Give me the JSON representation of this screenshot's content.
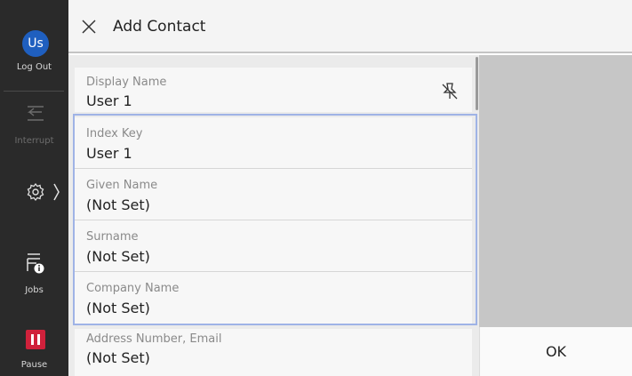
{
  "rail": {
    "avatar_text": "Us",
    "logout_label": "Log Out",
    "interrupt_label": "Interrupt",
    "jobs_label": "Jobs",
    "pause_label": "Pause",
    "accent_color": "#1f5fbf",
    "pause_color": "#d0213b"
  },
  "header": {
    "title": "Add Contact",
    "close_icon": "close-icon"
  },
  "fields": [
    {
      "label": "Display Name",
      "value": "User 1"
    },
    {
      "label": "Index Key",
      "value": "User 1"
    },
    {
      "label": "Given Name",
      "value": "(Not Set)"
    },
    {
      "label": "Surname",
      "value": "(Not Set)"
    },
    {
      "label": "Company Name",
      "value": "(Not Set)"
    },
    {
      "label": "Address Number, Email",
      "value": "(Not Set)"
    }
  ],
  "actions": {
    "ok_label": "OK"
  }
}
